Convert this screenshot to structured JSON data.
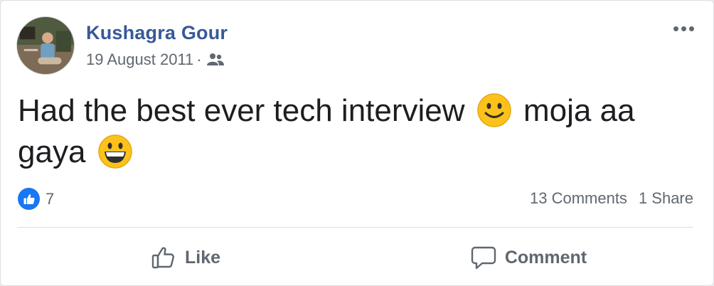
{
  "post": {
    "author": "Kushagra Gour",
    "date": "19 August 2011",
    "separator": "·",
    "audience_icon": "friends-icon",
    "text_part1": "Had the best ever tech interview",
    "text_part2": "moja aa gaya",
    "emoji_1": "slightly-smiling-face",
    "emoji_2": "grinning-face"
  },
  "reactions": {
    "icon": "thumbs-up-icon",
    "count": "7"
  },
  "stats": {
    "comments": "13 Comments",
    "shares": "1 Share"
  },
  "actions": {
    "like_label": "Like",
    "comment_label": "Comment"
  },
  "colors": {
    "author": "#385898",
    "secondary_text": "#606770",
    "like_blue": "#1877f2",
    "emoji_yellow": "#fcc21b"
  }
}
